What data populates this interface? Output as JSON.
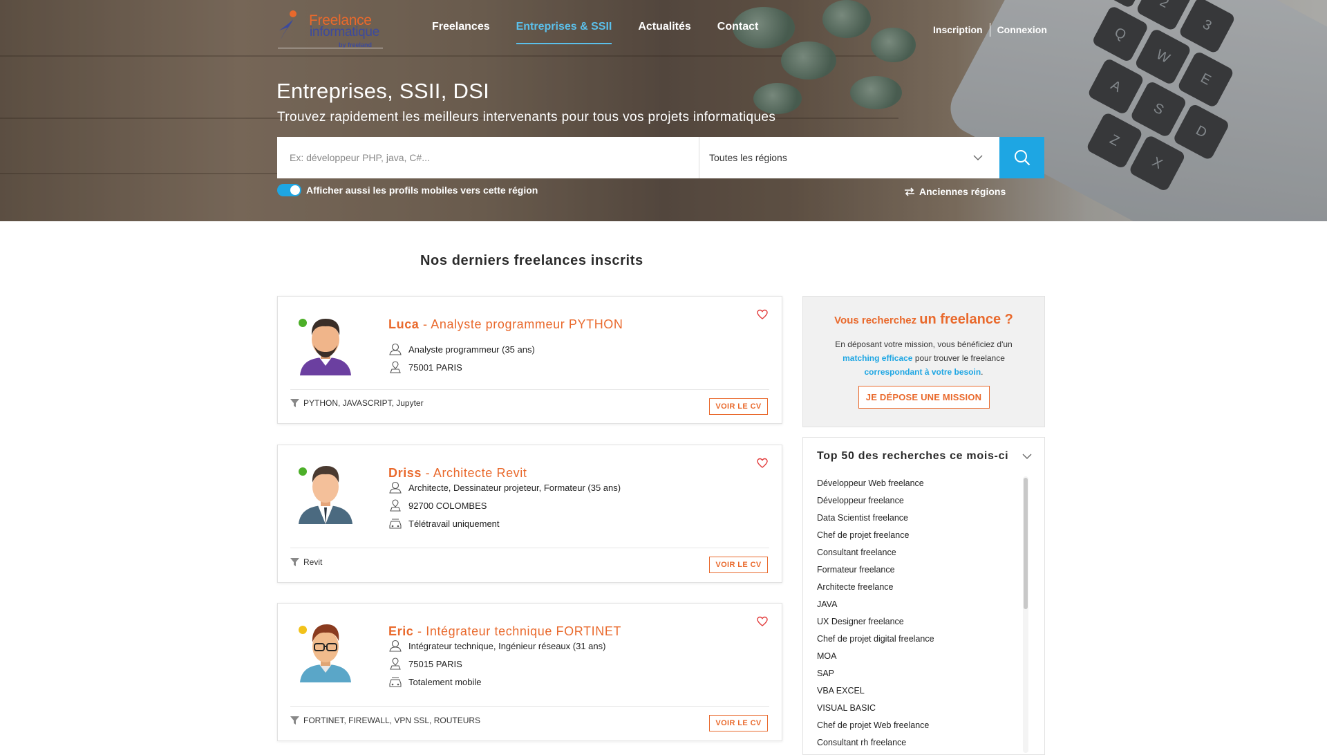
{
  "brand": {
    "logo_line1": "Freelance",
    "logo_line2": "informatique",
    "logo_line3": "by freeland"
  },
  "nav": {
    "items": [
      {
        "label": "Freelances",
        "active": false
      },
      {
        "label": "Entreprises & SSII",
        "active": true
      },
      {
        "label": "Actualités",
        "active": false
      },
      {
        "label": "Contact",
        "active": false
      }
    ],
    "signup": "Inscription",
    "login": "Connexion"
  },
  "hero": {
    "title": "Entreprises, SSII, DSI",
    "subtitle": "Trouvez rapidement les meilleurs intervenants pour tous vos projets informatiques"
  },
  "search": {
    "placeholder": "Ex: développeur PHP, java, C#...",
    "region_value": "Toutes les régions",
    "toggle_label": "Afficher aussi les profils mobiles vers cette région",
    "toggle_on": true,
    "old_regions_label": "Anciennes régions"
  },
  "main": {
    "section_title": "Nos derniers freelances inscrits",
    "freelancers": [
      {
        "name": "Luca",
        "title": " - Analyste programmeur PYTHON",
        "status_color": "#4caf28",
        "job": "Analyste programmeur (35 ans)",
        "location": "75001 PARIS",
        "mobility": null,
        "skills": "PYTHON, JAVASCRIPT, Jupyter",
        "cv_label": "VOIR LE CV"
      },
      {
        "name": "Driss",
        "title": " - Architecte Revit",
        "status_color": "#4caf28",
        "job": "Architecte, Dessinateur projeteur, Formateur (35 ans)",
        "location": "92700 COLOMBES",
        "mobility": "Télétravail uniquement",
        "skills": "Revit",
        "cv_label": "VOIR LE CV"
      },
      {
        "name": "Eric",
        "title": " - Intégrateur technique FORTINET",
        "status_color": "#f2c21a",
        "job": "Intégrateur technique, Ingénieur réseaux (31 ans)",
        "location": "75015 PARIS",
        "mobility": "Totalement mobile",
        "skills": "FORTINET, FIREWALL, VPN SSL, ROUTEURS",
        "cv_label": "VOIR LE CV"
      }
    ]
  },
  "sidebar": {
    "promo_pre": "Vous recherchez ",
    "promo_big": "un freelance ?",
    "promo_text_1": "En déposant votre mission, vous bénéficiez d'un ",
    "promo_hl_1": "matching efficace",
    "promo_text_2": " pour trouver le freelance ",
    "promo_hl_2": "correspondant à votre besoin",
    "promo_text_3": ".",
    "promo_button": "JE DÉPOSE UNE MISSION",
    "top50_title": "Top 50 des recherches ce mois-ci",
    "top50_items": [
      "Développeur Web freelance",
      "Développeur freelance",
      "Data Scientist freelance",
      "Chef de projet freelance",
      "Consultant freelance",
      "Formateur freelance",
      "Architecte freelance",
      "JAVA",
      "UX Designer freelance",
      "Chef de projet digital freelance",
      "MOA",
      "SAP",
      "VBA EXCEL",
      "VISUAL BASIC",
      "Chef de projet Web freelance",
      "Consultant rh freelance"
    ]
  },
  "colors": {
    "accent_orange": "#e9692c",
    "accent_blue": "#1ea6e3",
    "nav_active": "#5bc0eb"
  }
}
